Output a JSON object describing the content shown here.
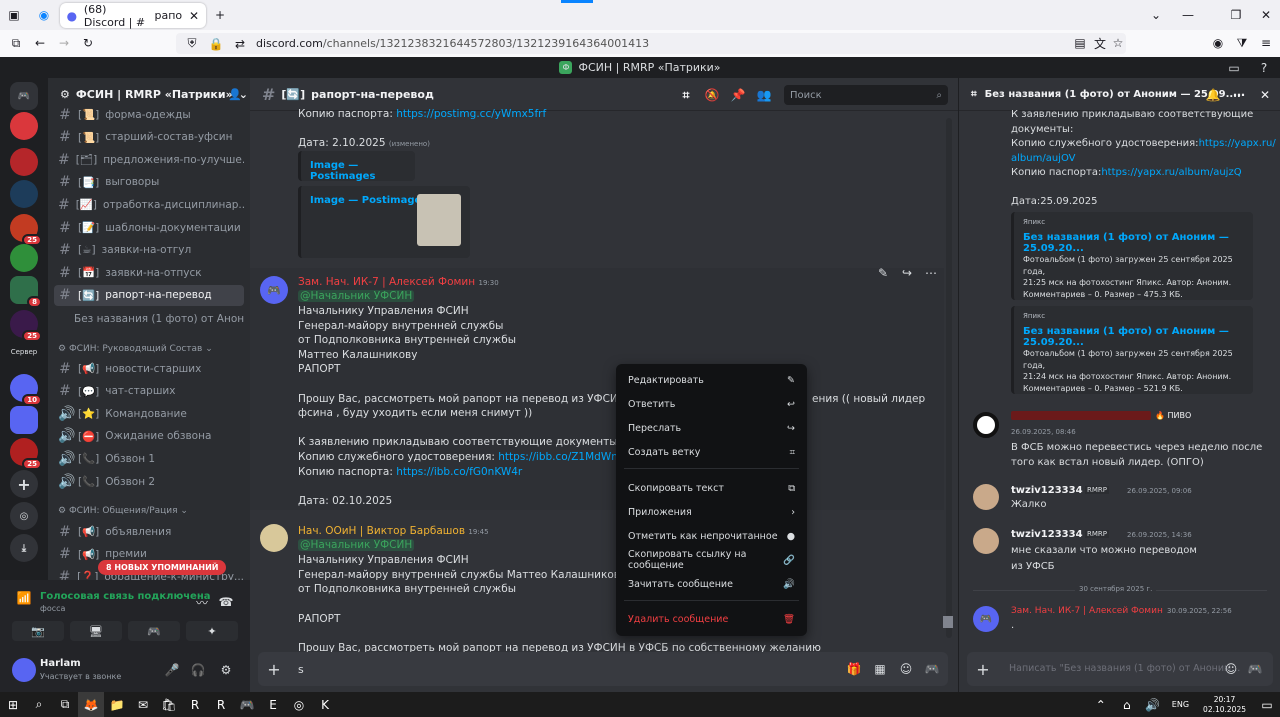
{
  "browser": {
    "tab_title": "(68) Discord | # ",
    "tab_title_suffix": "рапо",
    "url_host": "discord.com",
    "url_path": "/channels/1321238321644572803/1321239164364001413"
  },
  "window_title": "ФСИН | RMRP «Патрики»",
  "server": {
    "name": "ФСИН | RMRP «Патрики»"
  },
  "guild_badges": [
    "",
    "",
    "",
    "25",
    "",
    "8",
    "25",
    "",
    "10",
    "",
    "25"
  ],
  "guild_label": "Сервер",
  "channels": [
    {
      "name": "форма-одежды",
      "prefix": "[📜]"
    },
    {
      "name": "старший-состав-уфсин",
      "prefix": "[📜]"
    },
    {
      "name": "предложения-по-улучше...",
      "prefix": "[🗂]"
    },
    {
      "name": "выговоры",
      "prefix": "[📑]"
    },
    {
      "name": "отработка-дисциплинар...",
      "prefix": "[📈]"
    },
    {
      "name": "шаблоны-документации",
      "prefix": "[📝]"
    },
    {
      "name": "заявки-на-отгул",
      "prefix": "[☕]"
    },
    {
      "name": "заявки-на-отпуск",
      "prefix": "[📅]"
    },
    {
      "name": "рапорт-на-перевод",
      "prefix": "[🔄]"
    }
  ],
  "thread_item": "Без названия (1 фото) от Аноним...",
  "category_1": "ФСИН: Руководящий Состав",
  "channels_2": [
    {
      "name": "новости-старших",
      "prefix": "[📢]",
      "type": "text"
    },
    {
      "name": "чат-старших",
      "prefix": "[💬]",
      "type": "text"
    },
    {
      "name": "Командование",
      "prefix": "[⭐]",
      "type": "voice"
    },
    {
      "name": "Ожидание обзвона",
      "prefix": "[⛔]",
      "type": "voice"
    },
    {
      "name": "Обзвон 1",
      "prefix": "[📞]",
      "type": "voice"
    },
    {
      "name": "Обзвон 2",
      "prefix": "[📞]",
      "type": "voice"
    }
  ],
  "category_2": "ФСИН: Общения/Рация",
  "channels_3": [
    {
      "name": "объявления",
      "prefix": "[📢]"
    },
    {
      "name": "премии",
      "prefix": "[📢]"
    },
    {
      "name": "обращение-к-министру...",
      "prefix": "[❓]"
    }
  ],
  "new_mentions": "8 НОВЫХ УПОМИНАНИЙ",
  "voice": {
    "status": "Голосовая связь подключена",
    "sub": "фосса"
  },
  "user": {
    "name": "Harlam",
    "status": "Участвует в звонке"
  },
  "channel_header": {
    "name": "рапорт-на-перевод",
    "prefix": "[🔄]",
    "search": "Поиск"
  },
  "messages": {
    "top": {
      "passport_line": "Копию паспорта: ",
      "passport_link": "https://postimg.cc/yWmx5frf",
      "date": "Дата: 2.10.2025",
      "edited": "(изменено)",
      "embed1": "Image — Postimages",
      "embed2": "Image — Postimages"
    },
    "m1": {
      "author": "Зам. Нач. ИК-7 | Алексей Фомин",
      "time": "19:30",
      "mention": "@Начальник УФСИН",
      "lines": [
        "Начальнику Управления ФСИН",
        "Генерал-майору внутренней службы",
        "от Подполковника  внутренней службы",
        "Маттео Калашникову",
        "РАПОРТ"
      ],
      "request_1": "Прошу Вас, рассмотреть мой рапорт на перевод из УФСИН в УФСБ п",
      "request_1b": "ения (( новый лидер",
      "request_2": "фсина , буду уходить если меня снимут ))",
      "docs": "К заявлению прикладываю соответствующие документы:",
      "id_label": "Копию служебного удостоверения: ",
      "id_link": "https://ibb.co/Z1MdWmyL",
      "passport_label": "Копию паспорта: ",
      "passport_link": "https://ibb.co/fG0nKW4r",
      "date": "Дата: 02.10.2025"
    },
    "m2": {
      "author": "Нач. ООиН | Виктор Барбашов",
      "time": "19:45",
      "mention": "@Начальник УФСИН",
      "lines": [
        "Начальнику Управления ФСИН",
        "Генерал-майору внутренней службы Маттео Калашникову",
        "от Подполковника внутренней службы",
        "",
        "РАПОРТ",
        "",
        "Прошу Вас, рассмотреть мой рапорт на перевод из УФСИН в УФСБ по собственному желанию"
      ]
    }
  },
  "composer_text": "s",
  "context_menu": [
    {
      "label": "Редактировать",
      "icon": "✎"
    },
    {
      "label": "Ответить",
      "icon": "↩"
    },
    {
      "label": "Переслать",
      "icon": "↪"
    },
    {
      "label": "Создать ветку",
      "icon": "⌗"
    },
    {
      "label": "Скопировать текст",
      "icon": "⧉"
    },
    {
      "label": "Приложения",
      "icon": "›"
    },
    {
      "label": "Отметить как непрочитанное",
      "icon": "●"
    },
    {
      "label": "Скопировать ссылку на сообщение",
      "icon": "🔗"
    },
    {
      "label": "Зачитать сообщение",
      "icon": "🔊"
    },
    {
      "label": "Удалить сообщение",
      "icon": "🗑"
    }
  ],
  "thread": {
    "title": "Без названия (1 фото) от Аноним — 25.09....",
    "top_lines": [
      "К заявлению прикладываю соответствующие",
      "документы:"
    ],
    "id_label": "Копию служебного удостоверения:",
    "id_link_1": "https://yapx.ru/",
    "id_link_2": "album/aujOV",
    "passport_label": "Копию паспорта:",
    "passport_link": "https://yapx.ru/album/aujzQ",
    "date": "Дата:25.09.2025",
    "embeds": [
      {
        "provider": "Япикс",
        "title": "Без названия (1 фото) от Аноним — 25.09.20...",
        "desc": [
          "Фотоальбом (1 фото) загружен 25 сентября 2025 года,",
          "21:25 мск на фотохостинг Япикс. Автор: Аноним.",
          "Комментариев – 0. Размер – 475.3 КБ."
        ]
      },
      {
        "provider": "Япикс",
        "title": "Без названия (1 фото) от Аноним — 25.09.20...",
        "desc": [
          "Фотоальбом (1 фото) загружен 25 сентября 2025 года,",
          "21:24 мск на фотохостинг Япикс. Автор: Аноним.",
          "Комментариев – 0. Размер – 521.9 КБ."
        ]
      }
    ],
    "msgs": [
      {
        "author": "",
        "tag": "🔥 ПИВО",
        "time": "26.09.2025, 08:46",
        "lines": [
          "В ФСБ можно перевестись через неделю после",
          "того как встал новый лидер. (ОПГО)"
        ]
      },
      {
        "author": "twziv123334",
        "tag": "RMRP",
        "time": "26.09.2025, 09:06",
        "lines": [
          "Жалко"
        ]
      },
      {
        "author": "twziv123334",
        "tag": "RMRP",
        "time": "26.09.2025, 14:36",
        "lines": [
          "мне сказали что можно переводом",
          "из УФСБ"
        ]
      }
    ],
    "divider": "30 сентября 2025 г.",
    "last": {
      "author": "Зам. Нач. ИК-7 | Алексей Фомин",
      "time": "30.09.2025, 22:56",
      "text": "."
    },
    "composer_placeholder": "Написать \"Без названия (1 фото) от Аноним..."
  },
  "taskbar": {
    "lang": "ENG",
    "time": "20:17",
    "date": "02.10.2025"
  }
}
